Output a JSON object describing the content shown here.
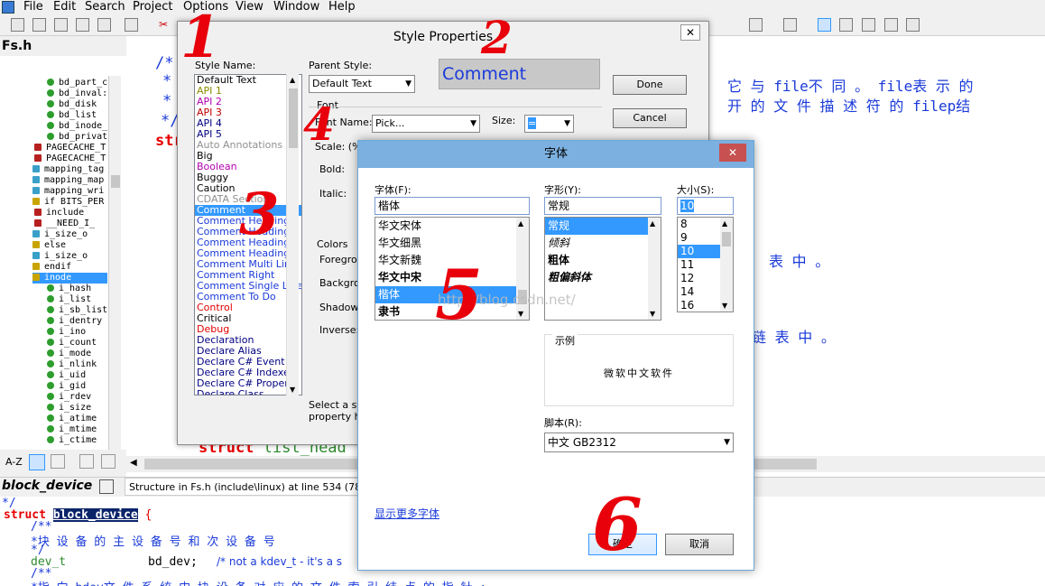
{
  "menu": [
    "File",
    "Edit",
    "Search",
    "Project",
    "Options",
    "View",
    "Window",
    "Help"
  ],
  "left_panel": {
    "file_title": "Fs.h",
    "symbols": [
      {
        "label": "bd_part_c",
        "kind": "field"
      },
      {
        "label": "bd_inval:",
        "kind": "field"
      },
      {
        "label": "bd_disk",
        "kind": "field"
      },
      {
        "label": "bd_list",
        "kind": "field"
      },
      {
        "label": "bd_inode_",
        "kind": "field"
      },
      {
        "label": "bd_privat",
        "kind": "field"
      },
      {
        "label": "PAGECACHE_T",
        "kind": "macro"
      },
      {
        "label": "PAGECACHE_T",
        "kind": "macro"
      },
      {
        "label": "mapping_tag",
        "kind": "func"
      },
      {
        "label": "mapping_map",
        "kind": "func"
      },
      {
        "label": "mapping_wri",
        "kind": "func"
      },
      {
        "label": "if BITS_PER",
        "kind": "cond"
      },
      {
        "label": "include",
        "kind": "macro"
      },
      {
        "label": "__NEED_I_",
        "kind": "macro"
      },
      {
        "label": "i_size_o",
        "kind": "func"
      },
      {
        "label": "else",
        "kind": "cond"
      },
      {
        "label": "i_size_o",
        "kind": "func"
      },
      {
        "label": "endif",
        "kind": "cond"
      },
      {
        "label": "inode",
        "kind": "cond"
      },
      {
        "label": "i_hash",
        "kind": "field"
      },
      {
        "label": "i_list",
        "kind": "field"
      },
      {
        "label": "i_sb_list",
        "kind": "field"
      },
      {
        "label": "i_dentry",
        "kind": "field"
      },
      {
        "label": "i_ino",
        "kind": "field"
      },
      {
        "label": "i_count",
        "kind": "field"
      },
      {
        "label": "i_mode",
        "kind": "field"
      },
      {
        "label": "i_nlink",
        "kind": "field"
      },
      {
        "label": "i_uid",
        "kind": "field"
      },
      {
        "label": "i_gid",
        "kind": "field"
      },
      {
        "label": "i_rdev",
        "kind": "field"
      },
      {
        "label": "i_size",
        "kind": "field"
      },
      {
        "label": "i_atime",
        "kind": "field"
      },
      {
        "label": "i_mtime",
        "kind": "field"
      },
      {
        "label": "i_ctime",
        "kind": "field"
      }
    ],
    "az_label": "A-Z"
  },
  "editor": {
    "comment_lines": [
      "/*",
      "*",
      "*",
      "*/"
    ],
    "struct_text": "str",
    "cn_line1": "它 与 file不 同 。 file表 示 的",
    "cn_line2": "开 的 文 件 描 述 符 的 filep结",
    "cn_line3": "表 中 。",
    "cn_line4": "链 表 中 。",
    "struct_list_head": "struct list_head"
  },
  "status": {
    "symbol_name": "block_device",
    "location": "Structure in Fs.h (include\\linux) at line 534 (78 lines)"
  },
  "bottom_code": {
    "line0": " */",
    "struct_kw": "struct",
    "struct_name": "block_device",
    "brace": "{",
    "c1": "/**",
    "c2": " *块 设 备 的 主 设 备 号 和 次 设 备 号",
    "c3": " */",
    "type": "dev_t",
    "field": "bd_dev;",
    "comment": "/* not a kdev_t - it's a s",
    "c4": "/**",
    "c5": " *指 向 bdev文 件 系 统 中 块 设 备 对 应 的 文 件 索 引 结 点 的 指 针 ;"
  },
  "style_dialog": {
    "title": "Style Properties",
    "style_name_label": "Style Name:",
    "parent_style_label": "Parent Style:",
    "parent_style_value": "Default Text",
    "preview_text": "Comment",
    "done": "Done",
    "cancel": "Cancel",
    "font_group": "Font",
    "font_name_label": "Font Name:",
    "font_name_value": "Pick...",
    "size_label": "Size:",
    "size_value": "=",
    "scale_label": "Scale: (%",
    "bold_label": "Bold:",
    "italic_label": "Italic:",
    "colors_group": "Colors",
    "foreground_label": "Foregrou",
    "background_label": "Backgro",
    "shadow_label": "Shadow:",
    "inverse_label": "Inverse:",
    "hint_line1": "Select a sty",
    "hint_line2": "property ha",
    "styles": [
      {
        "label": "Default Text",
        "color": "#000000"
      },
      {
        "label": "API 1",
        "color": "#8b8b00"
      },
      {
        "label": "API 2",
        "color": "#b000b0"
      },
      {
        "label": "API 3",
        "color": "#c00000"
      },
      {
        "label": "API 4",
        "color": "#000080"
      },
      {
        "label": "API 5",
        "color": "#000080"
      },
      {
        "label": "Auto Annotations",
        "color": "#909090"
      },
      {
        "label": "Big",
        "color": "#000000"
      },
      {
        "label": "Boolean",
        "color": "#b000b0"
      },
      {
        "label": "Buggy",
        "color": "#000000"
      },
      {
        "label": "Caution",
        "color": "#000000"
      },
      {
        "label": "CDATA Section",
        "color": "#909090"
      },
      {
        "label": "Comment",
        "color": "#ffffff",
        "selected": true
      },
      {
        "label": "Comment Heading 1",
        "color": "#1a3ad9"
      },
      {
        "label": "Comment Heading 2",
        "color": "#1a3ad9"
      },
      {
        "label": "Comment Heading 3",
        "color": "#1a3ad9"
      },
      {
        "label": "Comment Heading 4",
        "color": "#1a3ad9"
      },
      {
        "label": "Comment Multi Line",
        "color": "#1a3ad9"
      },
      {
        "label": "Comment Right",
        "color": "#1a3ad9"
      },
      {
        "label": "Comment Single Line",
        "color": "#1a3ad9"
      },
      {
        "label": "Comment To Do",
        "color": "#1a3ad9"
      },
      {
        "label": "Control",
        "color": "#e00000"
      },
      {
        "label": "Critical",
        "color": "#000000"
      },
      {
        "label": "Debug",
        "color": "#e00000"
      },
      {
        "label": "Declaration",
        "color": "#000080"
      },
      {
        "label": "Declare Alias",
        "color": "#000080"
      },
      {
        "label": "Declare C# Event",
        "color": "#000080"
      },
      {
        "label": "Declare C# Indexer",
        "color": "#000080"
      },
      {
        "label": "Declare C# Property",
        "color": "#000080"
      },
      {
        "label": "Declare Class",
        "color": "#000080"
      }
    ]
  },
  "font_dialog": {
    "title": "字体",
    "font_label": "字体(F):",
    "font_value": "楷体",
    "style_label": "字形(Y):",
    "style_value": "常规",
    "size_label": "大小(S):",
    "size_value": "10",
    "fonts": [
      {
        "label": "华文宋体",
        "selected": false
      },
      {
        "label": "华文细黑",
        "selected": false
      },
      {
        "label": "华文新魏",
        "selected": false
      },
      {
        "label": "华文中宋",
        "selected": false
      },
      {
        "label": "楷体",
        "selected": true
      },
      {
        "label": "隶书",
        "selected": false
      }
    ],
    "styles": [
      {
        "label": "常规",
        "selected": true
      },
      {
        "label": "倾斜",
        "selected": false
      },
      {
        "label": "粗体",
        "selected": false
      },
      {
        "label": "粗偏斜体",
        "selected": false
      }
    ],
    "sizes": [
      {
        "label": "8",
        "selected": false
      },
      {
        "label": "9",
        "selected": false
      },
      {
        "label": "10",
        "selected": true
      },
      {
        "label": "11",
        "selected": false
      },
      {
        "label": "12",
        "selected": false
      },
      {
        "label": "14",
        "selected": false
      },
      {
        "label": "16",
        "selected": false
      }
    ],
    "sample_label": "示例",
    "sample_text": "微软中文软件",
    "script_label": "脚本(R):",
    "script_value": "中文 GB2312",
    "more_fonts": "显示更多字体",
    "ok": "确定",
    "cancel": "取消",
    "watermark": "http://blog.csdn.net/"
  },
  "annotations": [
    "1",
    "2",
    "3",
    "4",
    "5",
    "6"
  ]
}
